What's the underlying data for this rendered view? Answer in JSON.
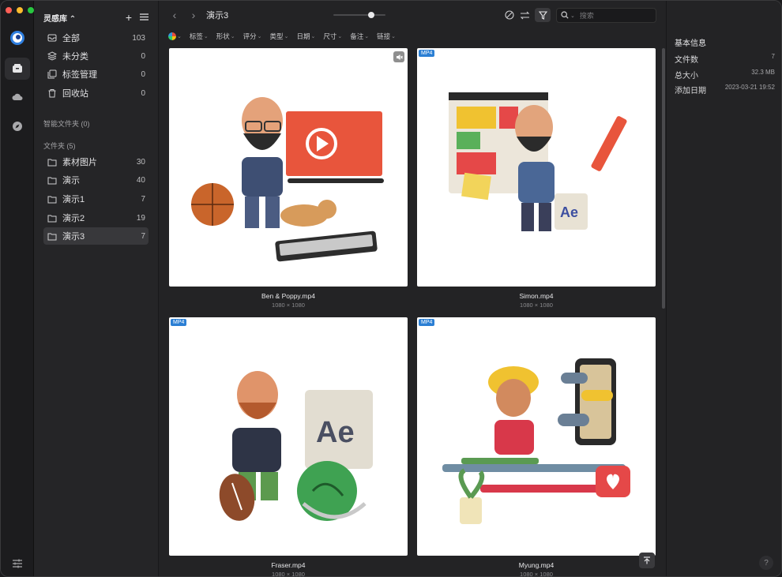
{
  "window": {
    "traffic_colors": [
      "#ff5f57",
      "#febc2e",
      "#28c840"
    ]
  },
  "rail": {
    "items": [
      "app-logo-icon",
      "library-icon",
      "cloud-icon",
      "compass-icon"
    ],
    "bottom": "settings-sliders-icon"
  },
  "sidebar": {
    "library_title": "灵感库 ⌃",
    "items": [
      {
        "label": "全部",
        "count": "103",
        "icon": "inbox-icon"
      },
      {
        "label": "未分类",
        "count": "0",
        "icon": "layers-icon"
      },
      {
        "label": "标签管理",
        "count": "0",
        "icon": "tags-icon"
      },
      {
        "label": "回收站",
        "count": "0",
        "icon": "trash-icon"
      }
    ],
    "smart_folders_label": "智能文件夹 (0)",
    "folders_label": "文件夹 (5)",
    "folders": [
      {
        "label": "素材图片",
        "count": "30"
      },
      {
        "label": "演示",
        "count": "40"
      },
      {
        "label": "演示1",
        "count": "7"
      },
      {
        "label": "演示2",
        "count": "19"
      },
      {
        "label": "演示3",
        "count": "7"
      }
    ]
  },
  "toolbar": {
    "title": "演示3",
    "zoom_level": 0.72,
    "search_placeholder": "搜索"
  },
  "filters": [
    "标签",
    "形状",
    "评分",
    "类型",
    "日期",
    "尺寸",
    "备注",
    "链接"
  ],
  "grid": {
    "items": [
      {
        "name": "Ben & Poppy.mp4",
        "dims": "1080 × 1080",
        "badge": "",
        "muted": true
      },
      {
        "name": "Simon.mp4",
        "dims": "1080 × 1080",
        "badge": "MP4",
        "muted": false
      },
      {
        "name": "Fraser.mp4",
        "dims": "1080 × 1080",
        "badge": "MP4",
        "muted": false
      },
      {
        "name": "Myung.mp4",
        "dims": "1080 × 1080",
        "badge": "MP4",
        "muted": false
      }
    ]
  },
  "info": {
    "title": "基本信息",
    "rows": [
      {
        "label": "文件数",
        "value": "7"
      },
      {
        "label": "总大小",
        "value": "32.3 MB"
      },
      {
        "label": "添加日期",
        "value": "2023-03-21 19:52"
      }
    ]
  },
  "help_label": "?"
}
